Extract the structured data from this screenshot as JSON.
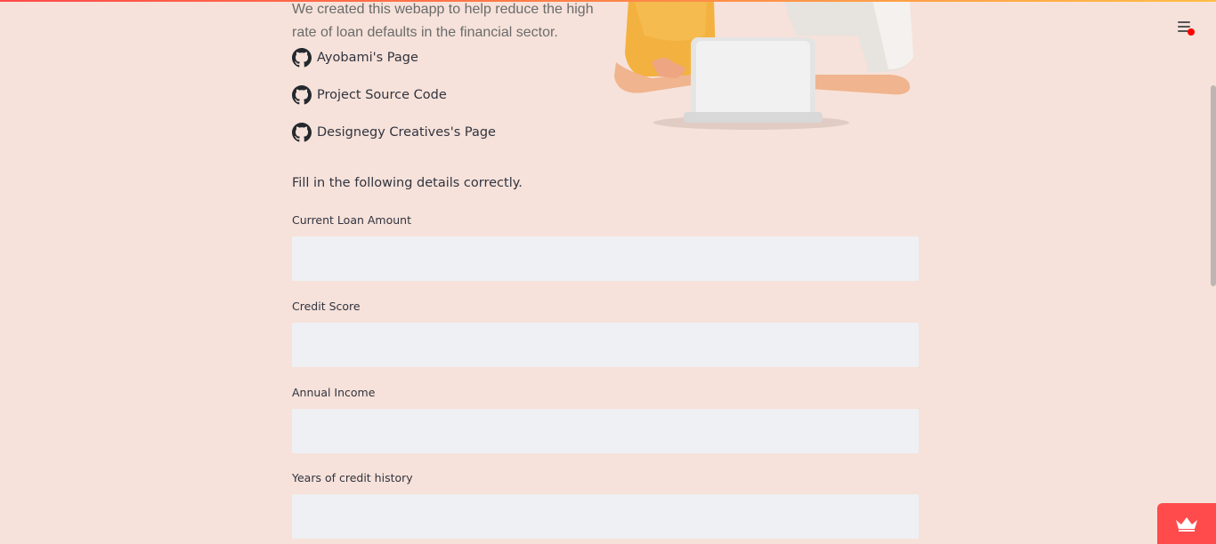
{
  "intro": {
    "partial_text": "We created this webapp to help reduce the high rate of loan defaults in the financial sector."
  },
  "links": [
    {
      "label": "Ayobami's Page",
      "icon": "github-icon"
    },
    {
      "label": "Project Source Code",
      "icon": "github-icon"
    },
    {
      "label": "Designegy Creatives's Page",
      "icon": "github-icon"
    }
  ],
  "form": {
    "instructions": "Fill in the following details correctly.",
    "fields": [
      {
        "label": "Current Loan Amount",
        "value": ""
      },
      {
        "label": "Credit Score",
        "value": ""
      },
      {
        "label": "Annual Income",
        "value": ""
      },
      {
        "label": "Years of credit history",
        "value": ""
      }
    ]
  },
  "colors": {
    "background": "#f6e2da",
    "input_background": "#eef0f3",
    "accent": "#ff4b4b"
  },
  "icons": {
    "menu": "hamburger-menu-icon",
    "badge": "crown-icon"
  }
}
